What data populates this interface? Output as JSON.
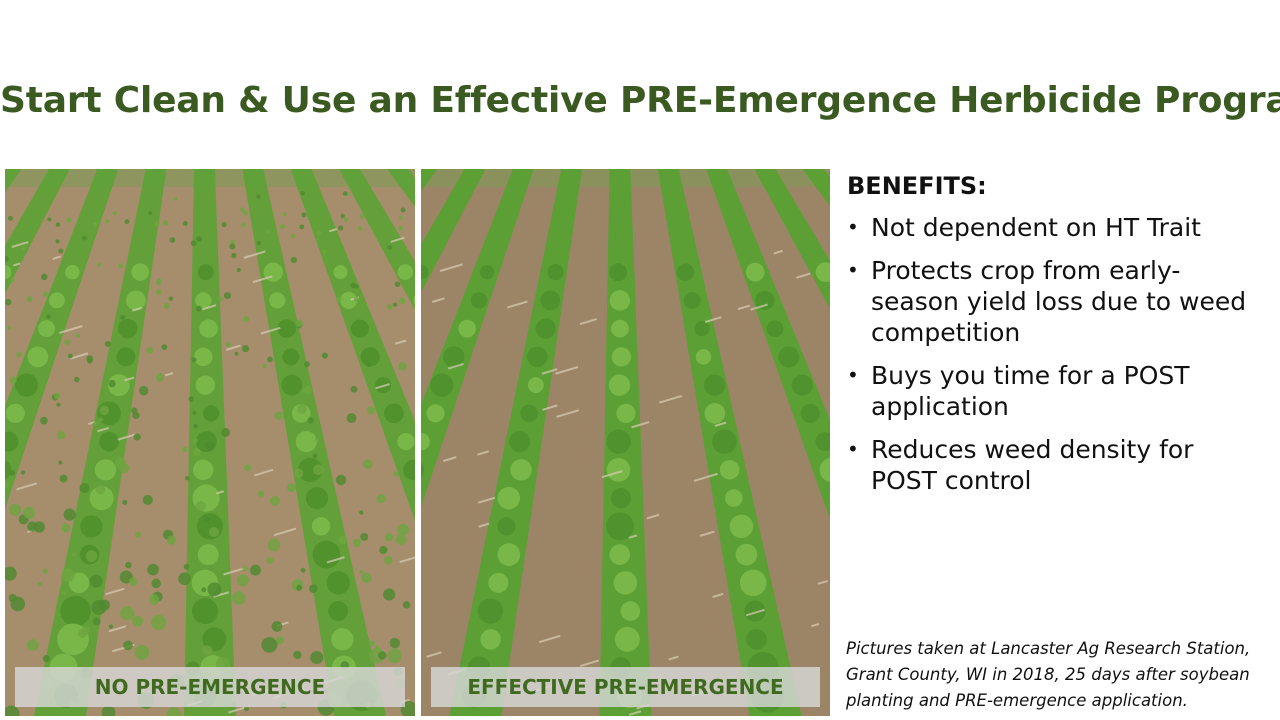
{
  "slide": {
    "title": "Start Clean & Use an Effective PRE-Emergence Herbicide Program"
  },
  "photos": [
    {
      "label": "NO PRE-EMERGENCE",
      "soil_color": "#a68e6c",
      "crop_color": "#5fa137",
      "weed_color": "#6ea540"
    },
    {
      "label": "EFFECTIVE PRE-EMERGENCE",
      "soil_color": "#9c8566",
      "crop_color": "#58a033"
    }
  ],
  "benefits": {
    "heading": "BENEFITS:",
    "bullet_glyph": "•",
    "items": [
      "Not dependent on HT Trait",
      "Protects crop from early-season yield loss due to weed competition",
      "Buys you time for a POST application",
      "Reduces weed density for POST control"
    ]
  },
  "caption": "Pictures taken at Lancaster Ag Research Station, Grant County, WI in 2018, 25 days after soybean planting and PRE-emergence application.",
  "colors": {
    "title": "#3a5a22",
    "label_text": "#3f6a1f"
  }
}
